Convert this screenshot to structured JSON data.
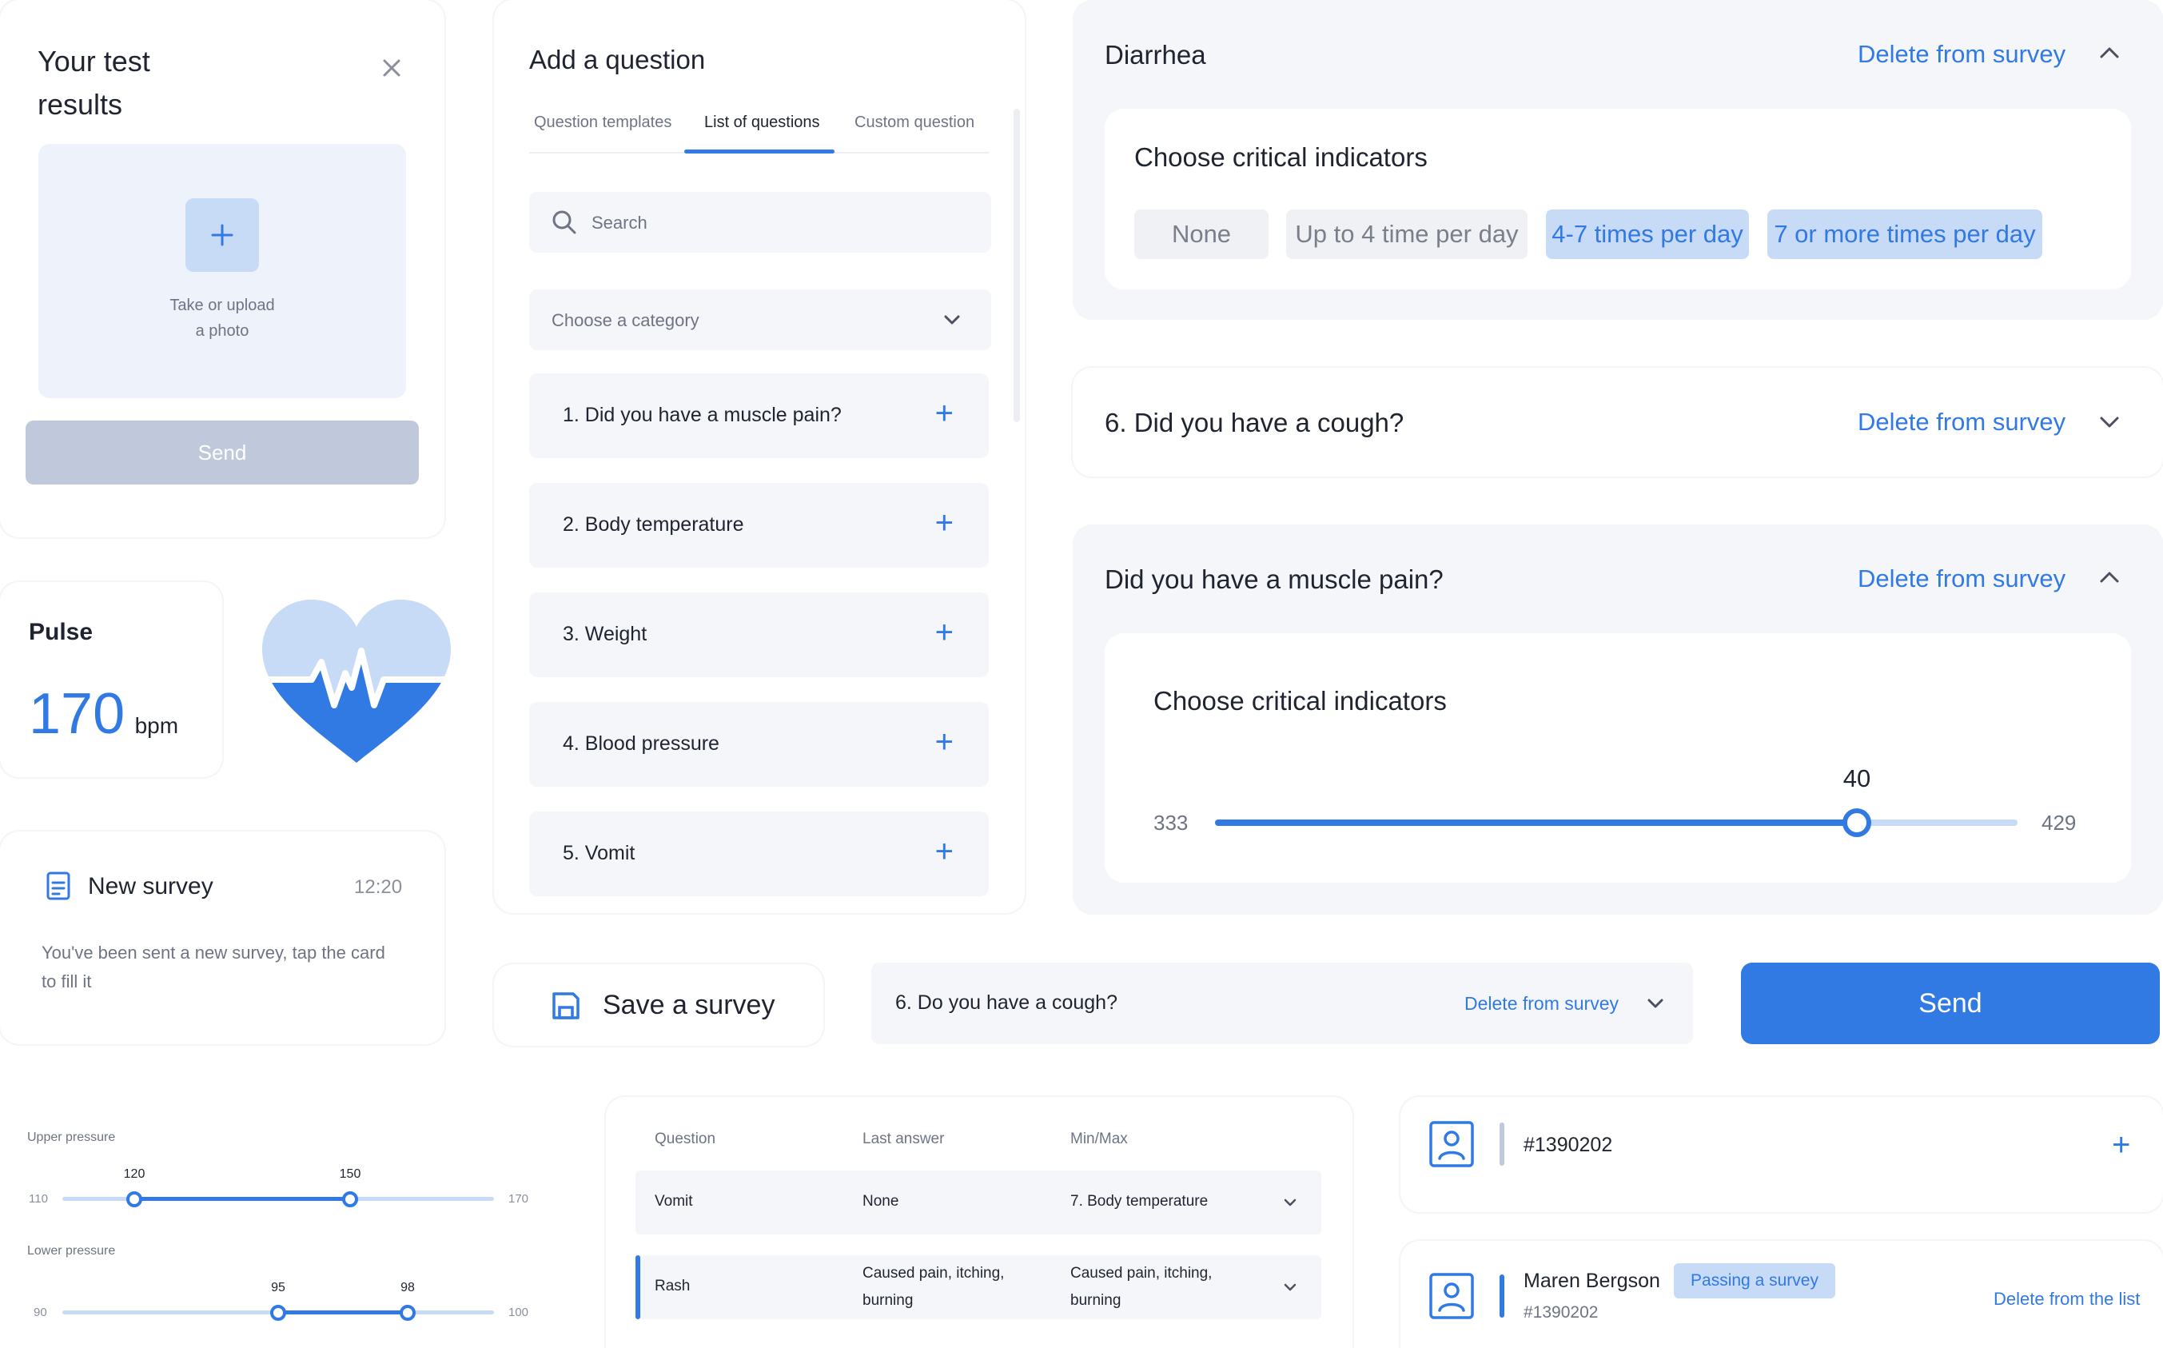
{
  "test_results": {
    "title_line1": "Your test",
    "title_line2": "results",
    "upload_line1": "Take or upload",
    "upload_line2": "a photo",
    "send_label": "Send"
  },
  "pulse": {
    "label": "Pulse",
    "value": "170",
    "unit": "bpm"
  },
  "new_survey": {
    "title": "New survey",
    "time": "12:20",
    "desc_line1": "You've been sent a new survey, tap the card",
    "desc_line2": "to fill it"
  },
  "add_question": {
    "title": "Add a question",
    "tabs": [
      {
        "label": "Question templates",
        "active": false
      },
      {
        "label": "List of questions",
        "active": true
      },
      {
        "label": "Custom question",
        "active": false
      }
    ],
    "search_placeholder": "Search",
    "category_placeholder": "Choose a category",
    "questions": [
      {
        "label": "1. Did you have a muscle pain?"
      },
      {
        "label": "2. Body temperature"
      },
      {
        "label": "3. Weight"
      },
      {
        "label": "4. Blood pressure"
      },
      {
        "label": "5. Vomit"
      }
    ]
  },
  "diarrhea": {
    "title": "Diarrhea",
    "delete_label": "Delete from survey",
    "indicators_title": "Choose critical indicators",
    "chips": [
      {
        "label": "None",
        "selected": false
      },
      {
        "label": "Up to 4 time per day",
        "selected": false
      },
      {
        "label": "4-7 times per day",
        "selected": true
      },
      {
        "label": "7 or more times per day",
        "selected": true
      }
    ]
  },
  "cough": {
    "title": "6. Did you have a cough?",
    "delete_label": "Delete from survey"
  },
  "muscle": {
    "title": "Did you have a muscle pain?",
    "delete_label": "Delete from survey",
    "indicators_title": "Choose critical indicators",
    "slider": {
      "min_label": "333",
      "max_label": "429",
      "value_label": "40",
      "fraction": 0.8
    }
  },
  "save_survey": {
    "label": "Save a survey"
  },
  "cough_row": {
    "label": "6. Do you have a cough?",
    "delete_label": "Delete from survey"
  },
  "send_button": {
    "label": "Send"
  },
  "pressure": {
    "upper": {
      "label": "Upper pressure",
      "min": "110",
      "max": "170",
      "low": "120",
      "high": "150",
      "low_frac": 0.1667,
      "high_frac": 0.6667
    },
    "lower": {
      "label": "Lower pressure",
      "min": "90",
      "max": "100",
      "low": "95",
      "high": "98",
      "low_frac": 0.5,
      "high_frac": 0.8
    }
  },
  "table": {
    "headers": [
      "Question",
      "Last answer",
      "Min/Max"
    ],
    "rows": [
      {
        "question": "Vomit",
        "last": "None",
        "minmax": "7. Body temperature"
      },
      {
        "question": "Rash",
        "last_line1": "Caused pain, itching,",
        "last_line2": "burning",
        "minmax_line1": "Caused pain, itching,",
        "minmax_line2": "burning"
      }
    ]
  },
  "patients": {
    "first": {
      "id": "#1390202"
    },
    "second": {
      "name": "Maren Bergson",
      "badge": "Passing a survey",
      "id": "#1390202",
      "delete_label": "Delete from the list"
    }
  },
  "colors": {
    "accent": "#3179e3",
    "accent_light": "#c7daf6",
    "surface": "#f5f6f9",
    "disabled": "#c0c8db"
  }
}
